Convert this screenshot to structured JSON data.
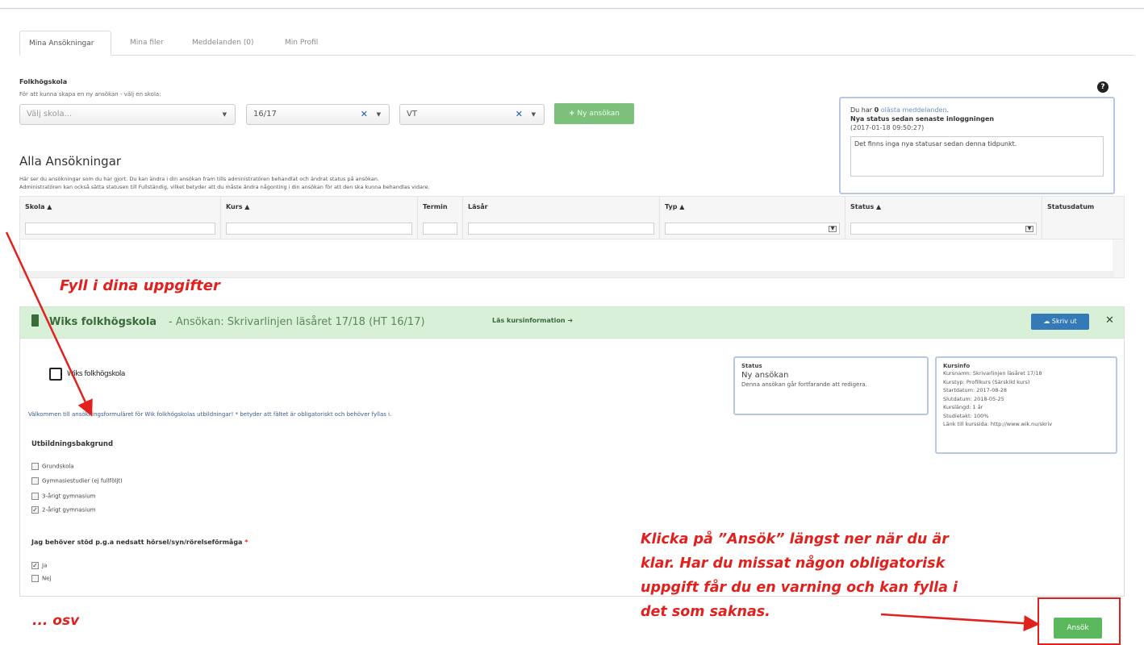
{
  "tabs": [
    {
      "label": "Mina Ansökningar",
      "active": true
    },
    {
      "label": "Mina filer",
      "active": false
    },
    {
      "label": "Meddelanden (0)",
      "active": false
    },
    {
      "label": "Min Profil",
      "active": false
    }
  ],
  "school_section": {
    "title": "Folkhögskola",
    "hint": "För att kunna skapa en ny ansökan - välj en skola:",
    "school_placeholder": "Välj skola...",
    "year_value": "16/17",
    "term_value": "VT",
    "new_button": "Ny ansökan"
  },
  "notice": {
    "prefix": "Du har",
    "count": "0",
    "link": "olästa meddelanden",
    "dot": ".",
    "status_heading": "Nya status sedan senaste inloggningen",
    "timestamp": "(2017-01-18 09:50:27)",
    "message": "Det finns inga nya statusar sedan denna tidpunkt."
  },
  "applications": {
    "title": "Alla Ansökningar",
    "desc1": "Här ser du ansökningar som du har gjort. Du kan ändra i din ansökan fram tills administratören behandlat och ändrat status på ansökan.",
    "desc2": "Administratören kan också sätta statusen till Fullständig, vilket betyder att du måste ändra någonting i din ansökan för att den ska kunna behandlas vidare.",
    "columns": [
      "Skola ▲",
      "Kurs ▲",
      "Termin",
      "Läsår",
      "Typ ▲",
      "Status ▲",
      "Statusdatum"
    ]
  },
  "panel": {
    "school": "Wiks folkhögskola",
    "application": " - Ansökan: Skrivarlinjen läsåret 17/18 (HT 16/17)",
    "course_info_link": "Läs kursinformation ➜",
    "print_button": "Skriv ut",
    "close": "✕",
    "logo_text": "Wiks folkhögskola",
    "welcome": "Välkommen till ansökningsformuläret för Wik folkhögskolas utbildningar! * betyder att fältet är obligatoriskt och behöver fyllas i.",
    "status_box": {
      "heading": "Status",
      "value": "Ny ansökan",
      "desc": "Denna ansökan går fortfarande att redigera."
    },
    "course_box": {
      "heading": "Kursinfo",
      "lines": [
        "Kursnamn: Skrivarlinjen läsåret 17/18",
        "Kurstyp: Profilkurs (Särskild kurs)",
        "Startdatum: 2017-08-28",
        "Slutdatum: 2018-05-25",
        "Kurslängd: 1 år",
        "Studietakt: 100%",
        "Länk till kurssida: http://www.wik.nu/skriv"
      ]
    },
    "education_title": "Utbildningsbakgrund",
    "education_options": [
      {
        "label": "Grundskola",
        "checked": false
      },
      {
        "label": "Gymnasiestudier (ej fullföljt)",
        "checked": false
      },
      {
        "label": "3-årigt gymnasium",
        "checked": false
      },
      {
        "label": "2-årigt gymnasium",
        "checked": true
      }
    ],
    "support_title": "Jag behöver stöd p.g.a nedsatt hörsel/syn/rörelseförmåga",
    "required_mark": "*",
    "support_options": [
      {
        "label": "Ja",
        "checked": true
      },
      {
        "label": "Nej",
        "checked": false
      }
    ],
    "apply_button": "Ansök"
  },
  "annotations": {
    "fill_in": "Fyll i dina uppgifter",
    "instruction_lines": [
      "Klicka på ”Ansök” längst ner när du är",
      "klar. Har du missat någon obligatorisk",
      "uppgift får du en varning och kan fylla i",
      "det som saknas."
    ],
    "etc": "... osv"
  },
  "colors": {
    "annotation_red": "#e0211d",
    "panel_green": "#d8efd8",
    "button_green": "#5cb85c",
    "print_blue": "#337ab7",
    "notice_border": "#b8c8e4"
  }
}
